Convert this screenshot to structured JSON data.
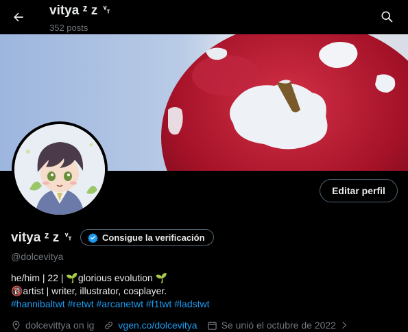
{
  "header": {
    "title": "vitya ᶻ z ␋",
    "posts_count": "352 posts",
    "back_icon": "arrow-left-icon",
    "search_icon": "search-icon"
  },
  "banner": {
    "description_icon": "banner-image"
  },
  "profile": {
    "edit_label": "Editar perfil",
    "display_name": "vitya ᶻ z ␋",
    "verify_label": "Consigue la verificación",
    "handle": "@dolcevitya",
    "bio_line1": "he/him | 22 | 🌱glorious evolution 🌱",
    "bio_line2": "🔞artist | writer, illustrator, cosplayer.",
    "bio_hashtags": "#hannibaltwt #retwt #arcanetwt #f1twt #ladstwt",
    "location": "dolcevittya on ig",
    "website": "vgen.co/dolcevitya",
    "joined": "Se unió el octubre de 2022"
  },
  "colors": {
    "background": "#000000",
    "text": "#e7e9ea",
    "muted": "#71767b",
    "link": "#1d9bf0",
    "border": "#536471"
  }
}
